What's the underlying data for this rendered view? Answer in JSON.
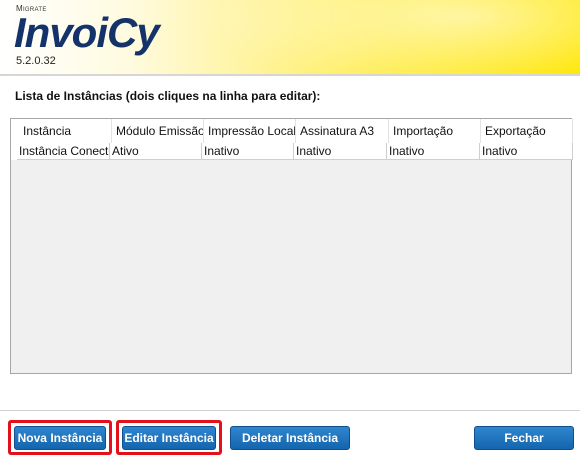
{
  "header": {
    "brand_small": "Migrate",
    "logo": "InvoiCy",
    "version": "5.2.0.32",
    "accent_color": "#ffe600",
    "logo_color": "#14336b"
  },
  "list": {
    "title": "Lista de Instâncias (dois cliques na linha para editar):",
    "columns": [
      "Instância",
      "Módulo Emissão",
      "Impressão Local",
      "Assinatura A3",
      "Importação",
      "Exportação"
    ],
    "rows": [
      [
        "Instância Conector",
        "Ativo",
        "Inativo",
        "Inativo",
        "Inativo",
        "Inativo"
      ]
    ]
  },
  "buttons": {
    "new": "Nova Instância",
    "edit": "Editar Instância",
    "delete": "Deletar Instância",
    "close": "Fechar",
    "color": "#1a6fb8",
    "highlight_color": "#e3101b"
  }
}
